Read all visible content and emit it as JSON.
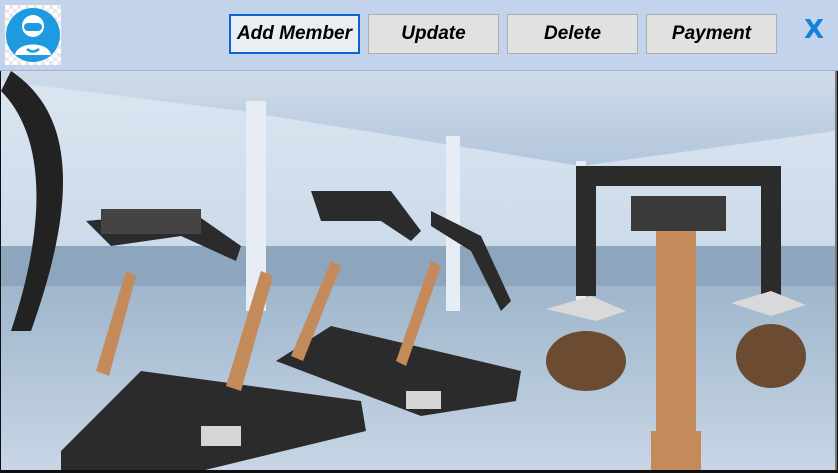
{
  "toolbar": {
    "add_member_label": "Add Member",
    "update_label": "Update",
    "delete_label": "Delete",
    "payment_label": "Payment",
    "close_label": "X"
  },
  "icons": {
    "avatar": "user-avatar-icon",
    "close": "close-icon"
  },
  "colors": {
    "header_bg": "#c3d3eb",
    "button_bg": "#e1e1e1",
    "focus_border": "#0a64d0",
    "avatar_blue": "#1e9ae0",
    "close_blue": "#1582d8"
  },
  "hero_image": {
    "subject": "gym-treadmills-photo"
  }
}
